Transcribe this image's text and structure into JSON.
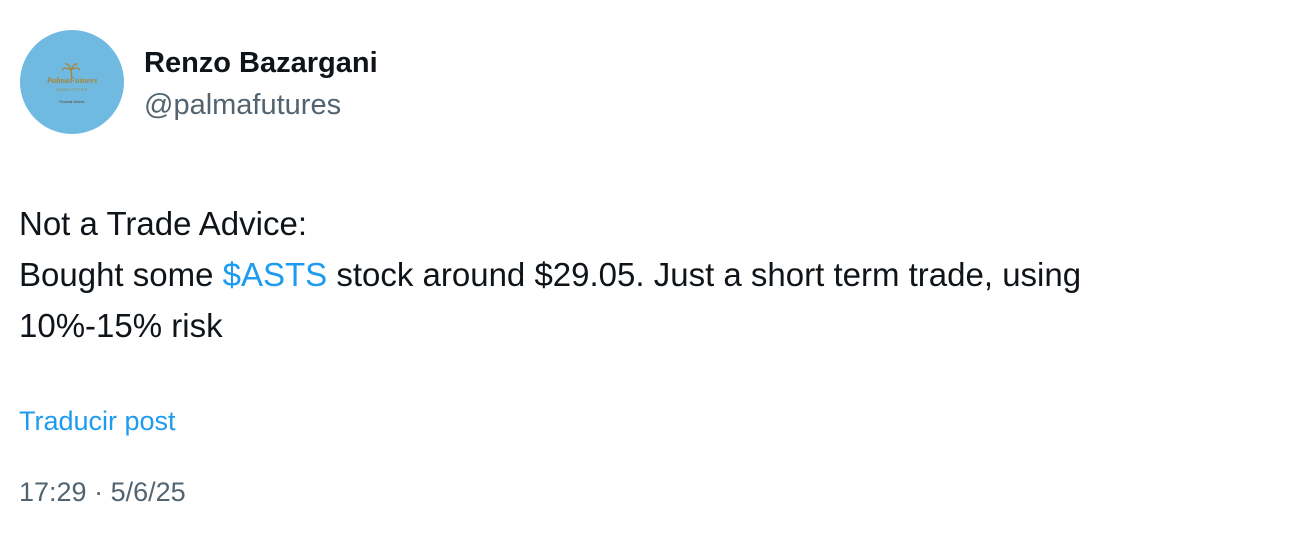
{
  "author": {
    "name": "Renzo Bazargani",
    "handle": "@palmafutures",
    "avatar": {
      "logo_title": "PalmaFutures",
      "logo_subtitle": "NEWSLETTER",
      "logo_tagline": "Financial Markets",
      "background_color": "#70b9e0",
      "logo_color": "#a8843a",
      "icon": "palm-tree-icon"
    }
  },
  "post": {
    "line1": "Not a Trade Advice:",
    "line2_before": "Bought some ",
    "cashtag": "$ASTS",
    "line2_after": " stock around $29.05. Just a short term trade, using",
    "line3": "10%-15% risk"
  },
  "translate_label": "Traducir post",
  "meta": {
    "time": "17:29",
    "separator": " · ",
    "date": "5/6/25"
  },
  "colors": {
    "text": "#0f1419",
    "secondary": "#536471",
    "link": "#1d9bf0",
    "background": "#ffffff"
  }
}
